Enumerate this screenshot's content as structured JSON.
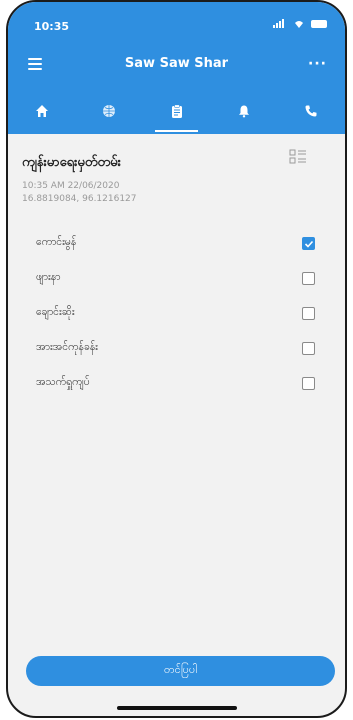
{
  "status": {
    "time": "10:35"
  },
  "appbar": {
    "title": "Saw Saw Shar"
  },
  "tabs": [
    {
      "icon": "home-icon"
    },
    {
      "icon": "globe-icon"
    },
    {
      "icon": "clipboard-icon",
      "active": true
    },
    {
      "icon": "bell-icon"
    },
    {
      "icon": "phone-icon"
    }
  ],
  "form": {
    "title": "ကျန်းမာရေးမှတ်တမ်း",
    "datetime": "10:35 AM 22/06/2020",
    "coords": "16.8819084, 96.1216127",
    "options": [
      {
        "label": "ကောင်းမွန်",
        "checked": true
      },
      {
        "label": "ဖျားနာ",
        "checked": false
      },
      {
        "label": "ချောင်းဆိုး",
        "checked": false
      },
      {
        "label": "အားအင်ကုန်ခန်း",
        "checked": false
      },
      {
        "label": "အသက်ရှူကျပ်",
        "checked": false
      }
    ],
    "submit_label": "တင်ပြပါ"
  },
  "colors": {
    "primary": "#2f8fe0",
    "background": "#f2f2f2"
  }
}
